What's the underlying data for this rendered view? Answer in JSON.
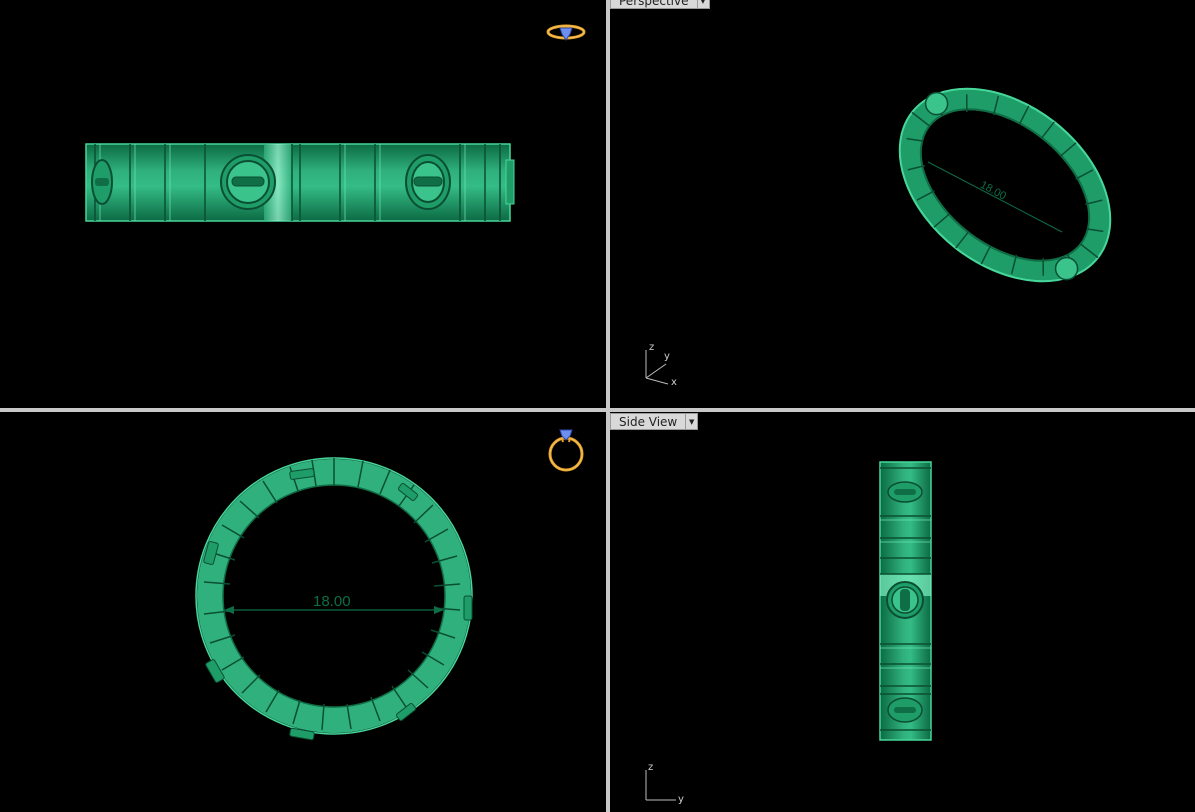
{
  "viewports": {
    "perspective": {
      "label": "Perspective"
    },
    "side": {
      "label": "Side View"
    }
  },
  "dimensions": {
    "front_diameter": "18.00",
    "perspective_diameter": "18.00"
  },
  "axes": {
    "perspective": {
      "z": "z",
      "y": "y",
      "x": "x"
    },
    "side": {
      "z": "z",
      "y": "y"
    }
  },
  "icons": {
    "top_view_gizmo": "ring-orientation-icon",
    "front_view_gizmo": "ring-orientation-icon",
    "viewport_menu": "chevron-down-icon"
  },
  "colors": {
    "model_green": "#2fb07c",
    "model_dark": "#0f6e46",
    "model_light": "#7ef0c2",
    "gizmo_gold": "#e8a32a",
    "gizmo_blue": "#4a66c8",
    "divider": "#c8c8c8"
  }
}
